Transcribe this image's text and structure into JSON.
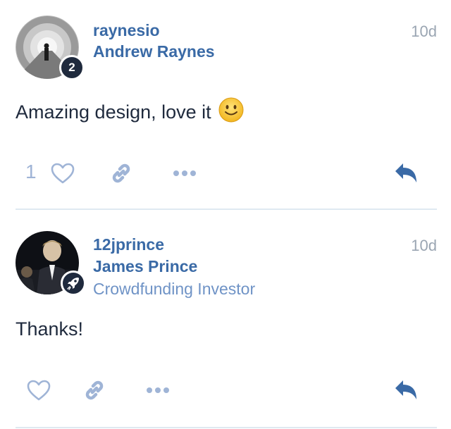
{
  "posts": [
    {
      "username": "raynesio",
      "fullname": "Andrew Raynes",
      "badge": "2",
      "date": "10d",
      "text": "Amazing design, love it",
      "emoji": "slightly-smiling-face",
      "like_count": "1"
    },
    {
      "username": "12jprince",
      "fullname": "James Prince",
      "user_title": "Crowdfunding Investor",
      "badge_icon": "rocket-icon",
      "date": "10d",
      "text": "Thanks!"
    }
  ],
  "colors": {
    "name": "#3a6aa6",
    "title": "#6f93c6",
    "action_icon": "#9fb4d6",
    "reply_icon": "#3a6aa6",
    "date": "#9aa5b2",
    "divider": "#dfe9f1"
  }
}
